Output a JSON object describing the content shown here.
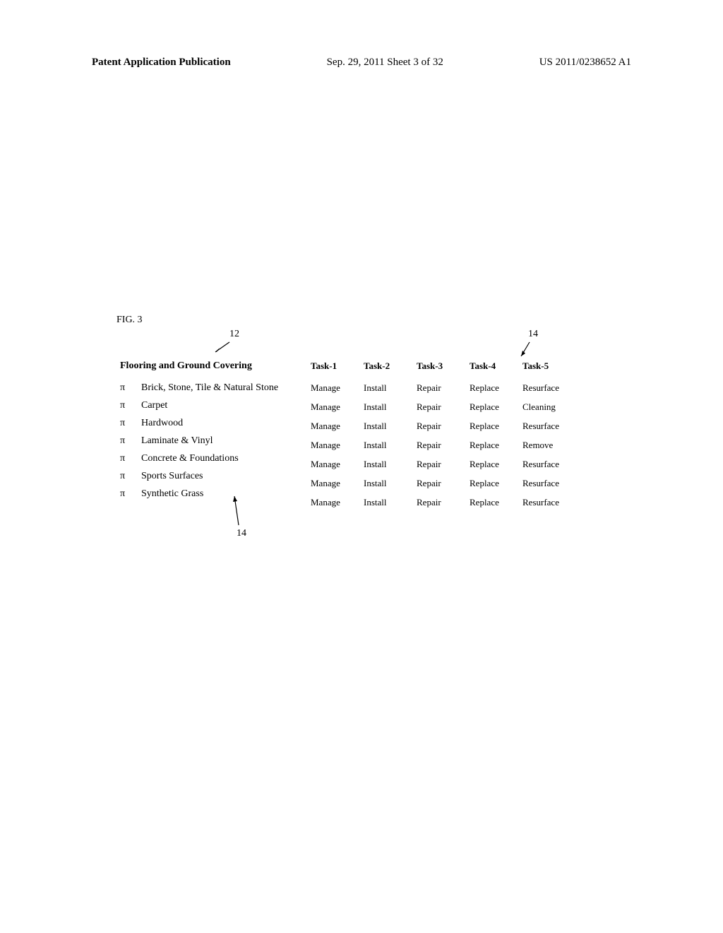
{
  "header": {
    "left": "Patent Application Publication",
    "center": "Sep. 29, 2011  Sheet 3 of 32",
    "right": "US 2011/0238652 A1"
  },
  "figure": {
    "label": "FIG. 3",
    "ref12": "12",
    "ref14top": "14",
    "ref14bottom": "14",
    "category_header": "Flooring and Ground Covering",
    "pi": "π",
    "categories": [
      "Brick, Stone, Tile & Natural Stone",
      "Carpet",
      "Hardwood",
      "Laminate & Vinyl",
      "Concrete & Foundations",
      "Sports Surfaces",
      "Synthetic Grass"
    ],
    "task_headers": [
      "Task-1",
      "Task-2",
      "Task-3",
      "Task-4",
      "Task-5"
    ],
    "task_data": [
      [
        "Manage",
        "Install",
        "Repair",
        "Replace",
        "Resurface"
      ],
      [
        "Manage",
        "Install",
        "Repair",
        "Replace",
        "Cleaning"
      ],
      [
        "Manage",
        "Install",
        "Repair",
        "Replace",
        "Resurface"
      ],
      [
        "Manage",
        "Install",
        "Repair",
        "Replace",
        "Remove"
      ],
      [
        "Manage",
        "Install",
        "Repair",
        "Replace",
        "Resurface"
      ],
      [
        "Manage",
        "Install",
        "Repair",
        "Replace",
        "Resurface"
      ],
      [
        "Manage",
        "Install",
        "Repair",
        "Replace",
        "Resurface"
      ]
    ]
  }
}
